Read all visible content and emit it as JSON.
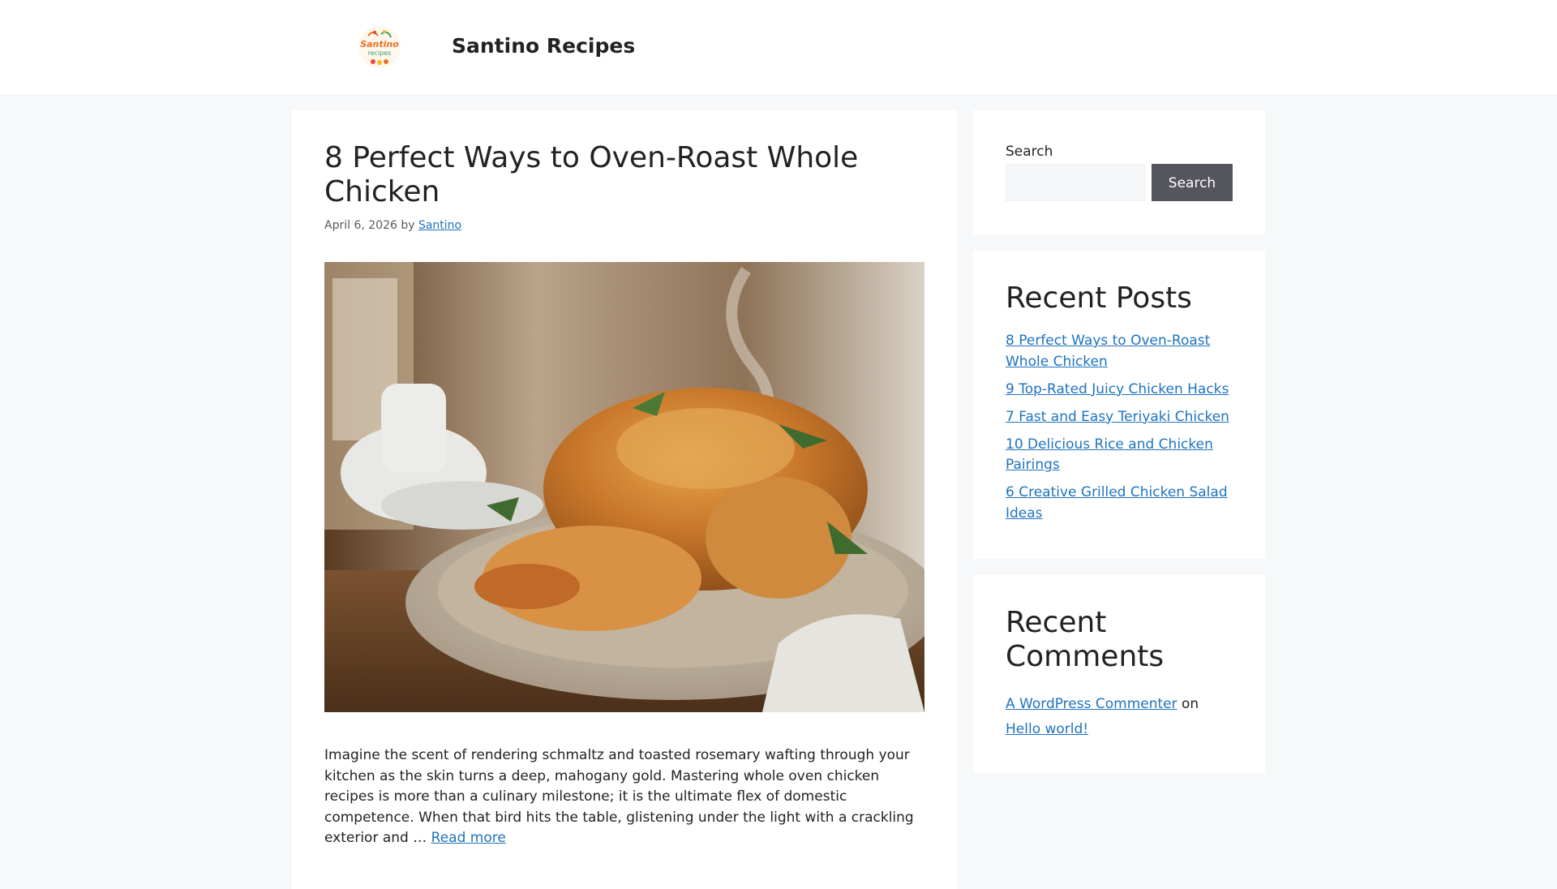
{
  "site": {
    "title": "Santino Recipes",
    "logo_text_top": "Santino",
    "logo_text_bottom": "recipes"
  },
  "post": {
    "title": "8 Perfect Ways to Oven-Roast Whole Chicken",
    "date": "April 6, 2026",
    "by": "by",
    "author": "Santino",
    "image_alt": "Oven-roasted whole chicken on a plate",
    "excerpt": "Imagine the scent of rendering schmaltz and toasted rosemary wafting through your kitchen as the skin turns a deep, mahogany gold. Mastering whole oven chicken recipes is more than a culinary milestone; it is the ultimate flex of domestic competence. When that bird hits the table, glistening under the light with a crackling exterior and …",
    "read_more": "Read more"
  },
  "sidebar": {
    "search": {
      "label": "Search",
      "button": "Search",
      "placeholder": ""
    },
    "recent_posts": {
      "heading": "Recent Posts",
      "items": [
        "8 Perfect Ways to Oven-Roast Whole Chicken",
        "9 Top-Rated Juicy Chicken Hacks",
        "7 Fast and Easy Teriyaki Chicken",
        "10 Delicious Rice and Chicken Pairings",
        "6 Creative Grilled Chicken Salad Ideas"
      ]
    },
    "recent_comments": {
      "heading": "Recent Comments",
      "commenter": "A WordPress Commenter",
      "on": "on",
      "post": "Hello world!"
    }
  },
  "colors": {
    "page_bg": "#f7f8f9",
    "link": "#1e73be",
    "button": "#55555e"
  }
}
